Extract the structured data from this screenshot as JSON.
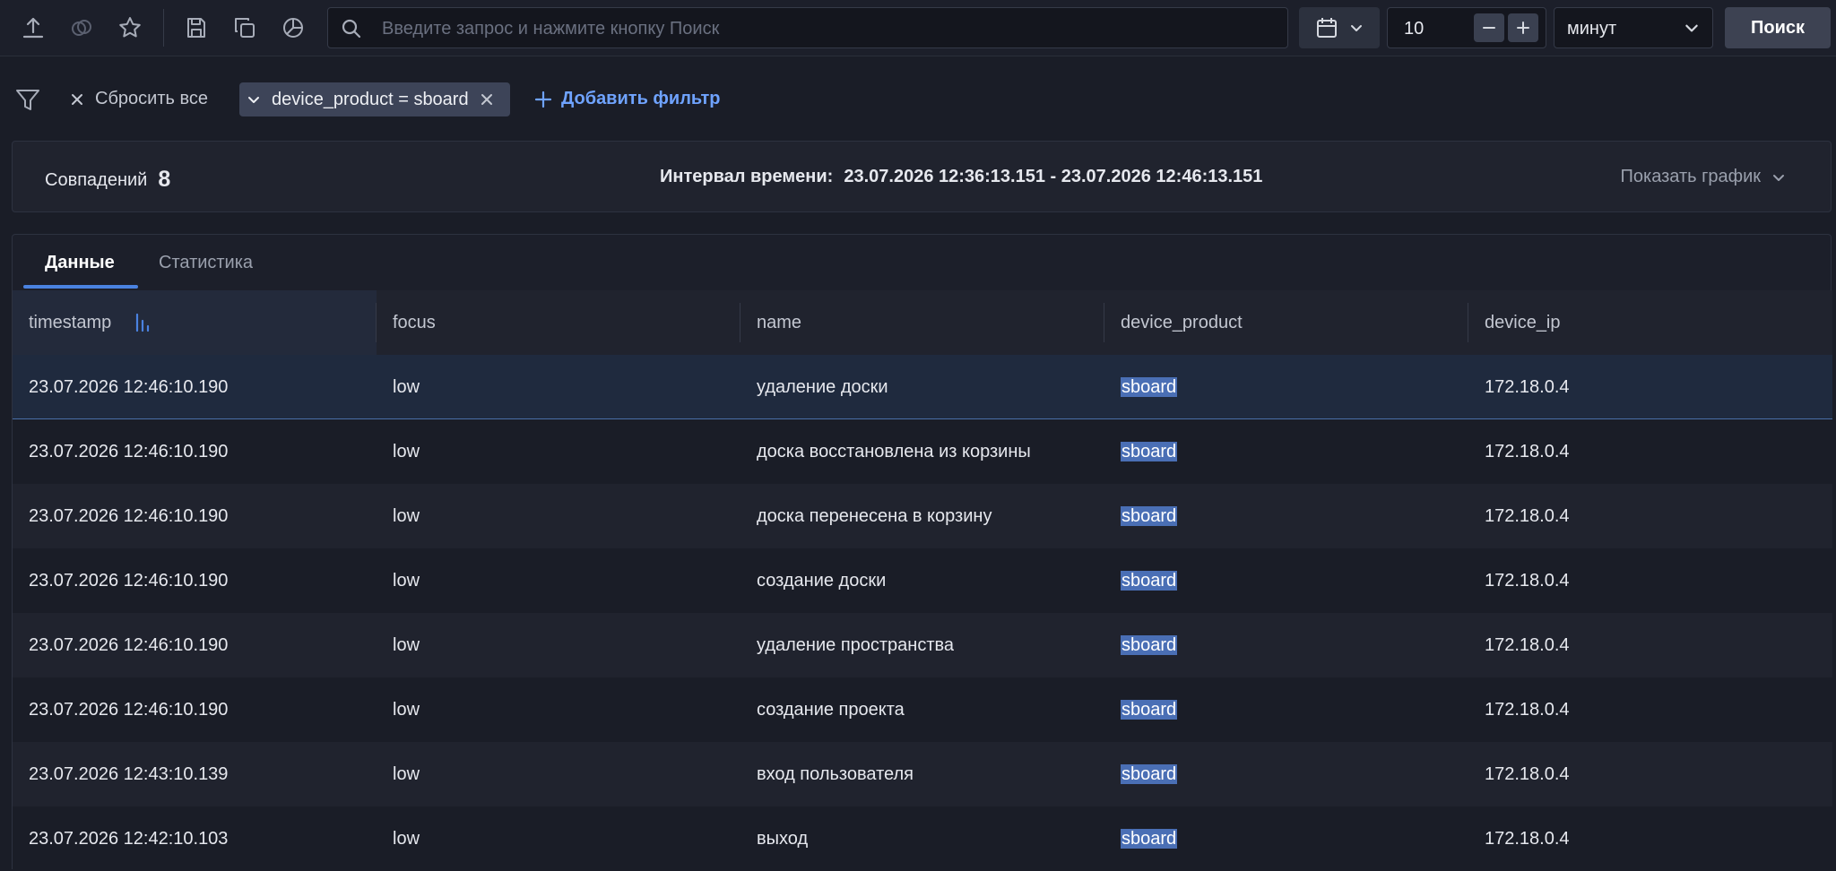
{
  "toolbar": {
    "search": {
      "placeholder": "Введите запрос и нажмите кнопку Поиск",
      "value": ""
    },
    "interval_value": "10",
    "interval_unit": "минут",
    "search_button": "Поиск"
  },
  "filters": {
    "reset_all": "Сбросить все",
    "chips": [
      {
        "label": "device_product = sboard"
      }
    ],
    "add_filter": "Добавить фильтр"
  },
  "summary": {
    "matches_label": "Совпадений",
    "matches_count": "8",
    "interval_label": "Интервал времени:",
    "interval_value": "23.07.2026 12:36:13.151 - 23.07.2026 12:46:13.151",
    "show_chart": "Показать график"
  },
  "tabs": [
    {
      "label": "Данные"
    },
    {
      "label": "Статистика"
    }
  ],
  "table": {
    "columns": [
      "timestamp",
      "focus",
      "name",
      "device_product",
      "device_ip"
    ],
    "rows": [
      [
        "23.07.2026 12:46:10.190",
        "low",
        "удаление доски",
        "sboard",
        "172.18.0.4"
      ],
      [
        "23.07.2026 12:46:10.190",
        "low",
        "доска восстановлена из корзины",
        "sboard",
        "172.18.0.4"
      ],
      [
        "23.07.2026 12:46:10.190",
        "low",
        "доска перенесена в корзину",
        "sboard",
        "172.18.0.4"
      ],
      [
        "23.07.2026 12:46:10.190",
        "low",
        "создание доски",
        "sboard",
        "172.18.0.4"
      ],
      [
        "23.07.2026 12:46:10.190",
        "low",
        "удаление пространства",
        "sboard",
        "172.18.0.4"
      ],
      [
        "23.07.2026 12:46:10.190",
        "low",
        "создание проекта",
        "sboard",
        "172.18.0.4"
      ],
      [
        "23.07.2026 12:43:10.139",
        "low",
        "вход пользователя",
        "sboard",
        "172.18.0.4"
      ],
      [
        "23.07.2026 12:42:10.103",
        "low",
        "выход",
        "sboard",
        "172.18.0.4"
      ]
    ]
  }
}
